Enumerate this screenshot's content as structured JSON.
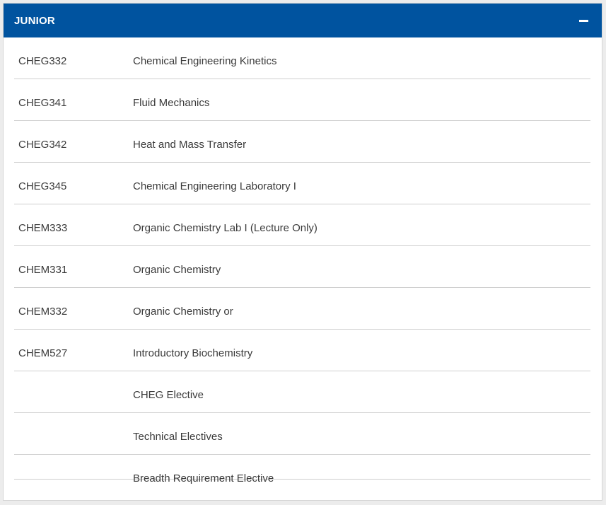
{
  "section": {
    "title": "JUNIOR",
    "toggle_icon": "minus-icon",
    "accent_color": "#00539f"
  },
  "courses": [
    {
      "code": "CHEG332",
      "title": "Chemical Engineering Kinetics"
    },
    {
      "code": "CHEG341",
      "title": "Fluid Mechanics"
    },
    {
      "code": "CHEG342",
      "title": "Heat and Mass Transfer"
    },
    {
      "code": "CHEG345",
      "title": "Chemical Engineering Laboratory I"
    },
    {
      "code": "CHEM333",
      "title": "Organic Chemistry Lab I (Lecture Only)"
    },
    {
      "code": "CHEM331",
      "title": "Organic Chemistry"
    },
    {
      "code": "CHEM332",
      "title": "Organic Chemistry or"
    },
    {
      "code": "CHEM527",
      "title": "Introductory Biochemistry"
    },
    {
      "code": "",
      "title": "CHEG Elective"
    },
    {
      "code": "",
      "title": "Technical Electives"
    },
    {
      "code": "",
      "title": "Breadth Requirement Elective"
    }
  ]
}
